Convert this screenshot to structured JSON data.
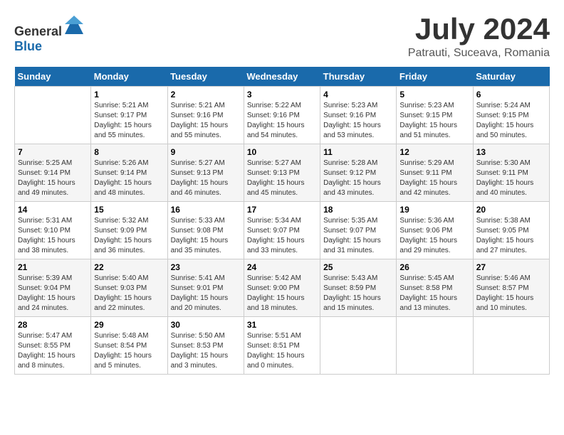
{
  "header": {
    "logo_general": "General",
    "logo_blue": "Blue",
    "month_year": "July 2024",
    "location": "Patrauti, Suceava, Romania"
  },
  "days_of_week": [
    "Sunday",
    "Monday",
    "Tuesday",
    "Wednesday",
    "Thursday",
    "Friday",
    "Saturday"
  ],
  "weeks": [
    [
      {
        "day": "",
        "info": ""
      },
      {
        "day": "1",
        "info": "Sunrise: 5:21 AM\nSunset: 9:17 PM\nDaylight: 15 hours\nand 55 minutes."
      },
      {
        "day": "2",
        "info": "Sunrise: 5:21 AM\nSunset: 9:16 PM\nDaylight: 15 hours\nand 55 minutes."
      },
      {
        "day": "3",
        "info": "Sunrise: 5:22 AM\nSunset: 9:16 PM\nDaylight: 15 hours\nand 54 minutes."
      },
      {
        "day": "4",
        "info": "Sunrise: 5:23 AM\nSunset: 9:16 PM\nDaylight: 15 hours\nand 53 minutes."
      },
      {
        "day": "5",
        "info": "Sunrise: 5:23 AM\nSunset: 9:15 PM\nDaylight: 15 hours\nand 51 minutes."
      },
      {
        "day": "6",
        "info": "Sunrise: 5:24 AM\nSunset: 9:15 PM\nDaylight: 15 hours\nand 50 minutes."
      }
    ],
    [
      {
        "day": "7",
        "info": "Sunrise: 5:25 AM\nSunset: 9:14 PM\nDaylight: 15 hours\nand 49 minutes."
      },
      {
        "day": "8",
        "info": "Sunrise: 5:26 AM\nSunset: 9:14 PM\nDaylight: 15 hours\nand 48 minutes."
      },
      {
        "day": "9",
        "info": "Sunrise: 5:27 AM\nSunset: 9:13 PM\nDaylight: 15 hours\nand 46 minutes."
      },
      {
        "day": "10",
        "info": "Sunrise: 5:27 AM\nSunset: 9:13 PM\nDaylight: 15 hours\nand 45 minutes."
      },
      {
        "day": "11",
        "info": "Sunrise: 5:28 AM\nSunset: 9:12 PM\nDaylight: 15 hours\nand 43 minutes."
      },
      {
        "day": "12",
        "info": "Sunrise: 5:29 AM\nSunset: 9:11 PM\nDaylight: 15 hours\nand 42 minutes."
      },
      {
        "day": "13",
        "info": "Sunrise: 5:30 AM\nSunset: 9:11 PM\nDaylight: 15 hours\nand 40 minutes."
      }
    ],
    [
      {
        "day": "14",
        "info": "Sunrise: 5:31 AM\nSunset: 9:10 PM\nDaylight: 15 hours\nand 38 minutes."
      },
      {
        "day": "15",
        "info": "Sunrise: 5:32 AM\nSunset: 9:09 PM\nDaylight: 15 hours\nand 36 minutes."
      },
      {
        "day": "16",
        "info": "Sunrise: 5:33 AM\nSunset: 9:08 PM\nDaylight: 15 hours\nand 35 minutes."
      },
      {
        "day": "17",
        "info": "Sunrise: 5:34 AM\nSunset: 9:07 PM\nDaylight: 15 hours\nand 33 minutes."
      },
      {
        "day": "18",
        "info": "Sunrise: 5:35 AM\nSunset: 9:07 PM\nDaylight: 15 hours\nand 31 minutes."
      },
      {
        "day": "19",
        "info": "Sunrise: 5:36 AM\nSunset: 9:06 PM\nDaylight: 15 hours\nand 29 minutes."
      },
      {
        "day": "20",
        "info": "Sunrise: 5:38 AM\nSunset: 9:05 PM\nDaylight: 15 hours\nand 27 minutes."
      }
    ],
    [
      {
        "day": "21",
        "info": "Sunrise: 5:39 AM\nSunset: 9:04 PM\nDaylight: 15 hours\nand 24 minutes."
      },
      {
        "day": "22",
        "info": "Sunrise: 5:40 AM\nSunset: 9:03 PM\nDaylight: 15 hours\nand 22 minutes."
      },
      {
        "day": "23",
        "info": "Sunrise: 5:41 AM\nSunset: 9:01 PM\nDaylight: 15 hours\nand 20 minutes."
      },
      {
        "day": "24",
        "info": "Sunrise: 5:42 AM\nSunset: 9:00 PM\nDaylight: 15 hours\nand 18 minutes."
      },
      {
        "day": "25",
        "info": "Sunrise: 5:43 AM\nSunset: 8:59 PM\nDaylight: 15 hours\nand 15 minutes."
      },
      {
        "day": "26",
        "info": "Sunrise: 5:45 AM\nSunset: 8:58 PM\nDaylight: 15 hours\nand 13 minutes."
      },
      {
        "day": "27",
        "info": "Sunrise: 5:46 AM\nSunset: 8:57 PM\nDaylight: 15 hours\nand 10 minutes."
      }
    ],
    [
      {
        "day": "28",
        "info": "Sunrise: 5:47 AM\nSunset: 8:55 PM\nDaylight: 15 hours\nand 8 minutes."
      },
      {
        "day": "29",
        "info": "Sunrise: 5:48 AM\nSunset: 8:54 PM\nDaylight: 15 hours\nand 5 minutes."
      },
      {
        "day": "30",
        "info": "Sunrise: 5:50 AM\nSunset: 8:53 PM\nDaylight: 15 hours\nand 3 minutes."
      },
      {
        "day": "31",
        "info": "Sunrise: 5:51 AM\nSunset: 8:51 PM\nDaylight: 15 hours\nand 0 minutes."
      },
      {
        "day": "",
        "info": ""
      },
      {
        "day": "",
        "info": ""
      },
      {
        "day": "",
        "info": ""
      }
    ]
  ]
}
